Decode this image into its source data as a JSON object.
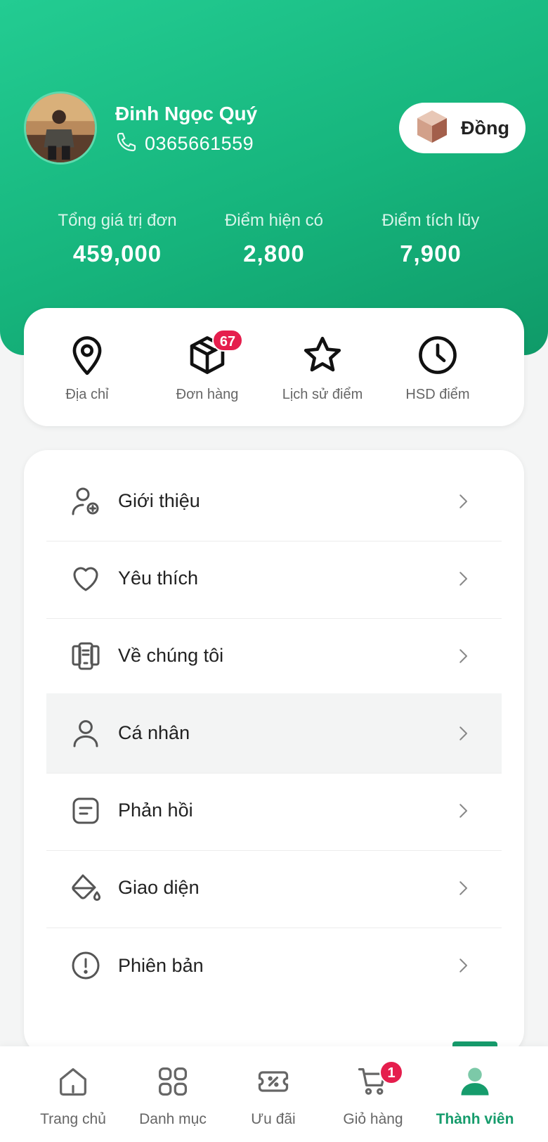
{
  "profile": {
    "name": "Đinh Ngọc Quý",
    "phone": "0365661559",
    "tier": "Đồng"
  },
  "stats": [
    {
      "label": "Tổng giá trị đơn",
      "value": "459,000"
    },
    {
      "label": "Điểm hiện có",
      "value": "2,800"
    },
    {
      "label": "Điểm tích lũy",
      "value": "7,900"
    }
  ],
  "quick_actions": [
    {
      "label": "Địa chỉ",
      "icon": "location-pin-icon"
    },
    {
      "label": "Đơn hàng",
      "icon": "box-icon",
      "badge": "67"
    },
    {
      "label": "Lịch sử điểm",
      "icon": "star-icon"
    },
    {
      "label": "HSD điểm",
      "icon": "clock-icon"
    }
  ],
  "menu": [
    {
      "label": "Giới thiệu",
      "icon": "user-add-icon"
    },
    {
      "label": "Yêu thích",
      "icon": "heart-icon"
    },
    {
      "label": "Về chúng tôi",
      "icon": "documents-icon"
    },
    {
      "label": "Cá nhân",
      "icon": "user-icon",
      "selected": true
    },
    {
      "label": "Phản hồi",
      "icon": "feedback-icon"
    },
    {
      "label": "Giao diện",
      "icon": "paint-bucket-icon"
    },
    {
      "label": "Phiên bản",
      "icon": "info-alert-icon"
    }
  ],
  "tabs": [
    {
      "label": "Trang chủ",
      "icon": "home-icon"
    },
    {
      "label": "Danh mục",
      "icon": "grid-icon"
    },
    {
      "label": "Ưu đãi",
      "icon": "ticket-icon"
    },
    {
      "label": "Giỏ hàng",
      "icon": "cart-icon",
      "badge": "1"
    },
    {
      "label": "Thành viên",
      "icon": "member-icon",
      "active": true
    }
  ],
  "colors": {
    "brand": "#169c6c",
    "header_start": "#23cc92",
    "badge": "#e51e4d"
  }
}
